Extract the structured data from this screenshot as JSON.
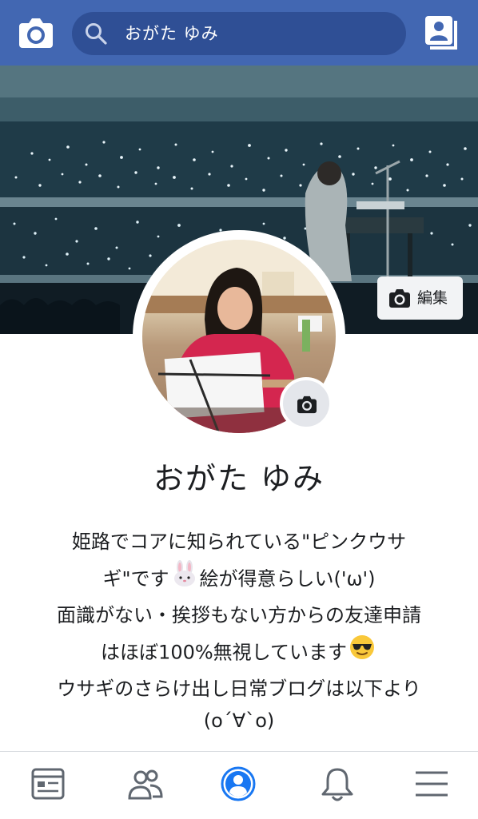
{
  "header": {
    "search_text": "おがた ゆみ",
    "camera_icon": "camera-icon",
    "search_icon": "search-icon",
    "profile_icon": "profile-switch-icon"
  },
  "cover": {
    "edit_label": "編集"
  },
  "profile": {
    "name": "おがた ゆみ"
  },
  "bio": {
    "lines": [
      "姫路でコアに知られている\"ピンクウサ",
      "ギ\"です",
      "絵が得意らしい('ω')",
      "面識がない・挨拶もない方からの友達申請",
      "はほぼ100%無視しています",
      "ウサギのさらけ出し日常ブログは以下より",
      "(o´∀`o)"
    ]
  },
  "nav": {
    "items": [
      "news-feed-icon",
      "friends-icon",
      "profile-icon",
      "notifications-icon",
      "menu-icon"
    ],
    "active": "profile-icon"
  },
  "colors": {
    "brand": "#4267b2",
    "search_bg": "#2f4f95",
    "active_nav": "#1877f2"
  }
}
